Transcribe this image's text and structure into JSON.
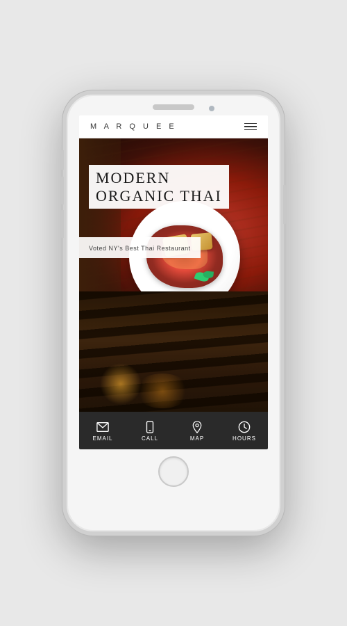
{
  "phone": {
    "screen": {
      "header": {
        "logo": "M A R Q U E E",
        "menu_icon_label": "menu"
      },
      "hero": {
        "title_line1": "MODERN",
        "title_line2": "ORGANIC THAI",
        "subtitle": "Voted NY's Best Thai Restaurant"
      },
      "bottom_nav": {
        "items": [
          {
            "id": "email",
            "label": "EMAIL",
            "icon": "email-icon"
          },
          {
            "id": "call",
            "label": "CALL",
            "icon": "phone-icon"
          },
          {
            "id": "map",
            "label": "MAP",
            "icon": "map-icon"
          },
          {
            "id": "hours",
            "label": "HOURS",
            "icon": "clock-icon"
          }
        ]
      }
    }
  }
}
